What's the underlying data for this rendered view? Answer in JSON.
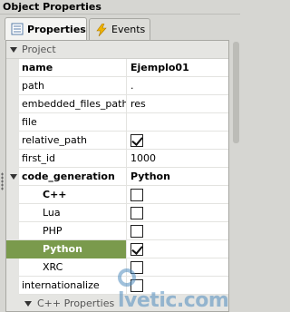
{
  "window": {
    "title": "Object Properties"
  },
  "tabs": [
    {
      "label": "Properties",
      "icon": "properties-icon"
    },
    {
      "label": "Events",
      "icon": "lightning-icon"
    }
  ],
  "sections": {
    "project": "Project",
    "cpp_properties": "C++ Properties"
  },
  "properties": {
    "name": {
      "label": "name",
      "value": "Ejemplo01"
    },
    "path": {
      "label": "path",
      "value": "."
    },
    "embedded_files_path": {
      "label": "embedded_files_path",
      "value": "res"
    },
    "file": {
      "label": "file",
      "value": ""
    },
    "relative_path": {
      "label": "relative_path",
      "checked": true
    },
    "first_id": {
      "label": "first_id",
      "value": "1000"
    },
    "code_generation": {
      "label": "code_generation",
      "value": "Python"
    },
    "cpp": {
      "label": "C++",
      "checked": false
    },
    "lua": {
      "label": "Lua",
      "checked": false
    },
    "php": {
      "label": "PHP",
      "checked": false
    },
    "python": {
      "label": "Python",
      "checked": true
    },
    "xrc": {
      "label": "XRC",
      "checked": false
    },
    "internationalize": {
      "label": "internationalize",
      "checked": false
    }
  },
  "watermark": "olvetic.com",
  "colors": {
    "selected_row": "#7a9a4c",
    "section_header": "#e5e5e2"
  }
}
